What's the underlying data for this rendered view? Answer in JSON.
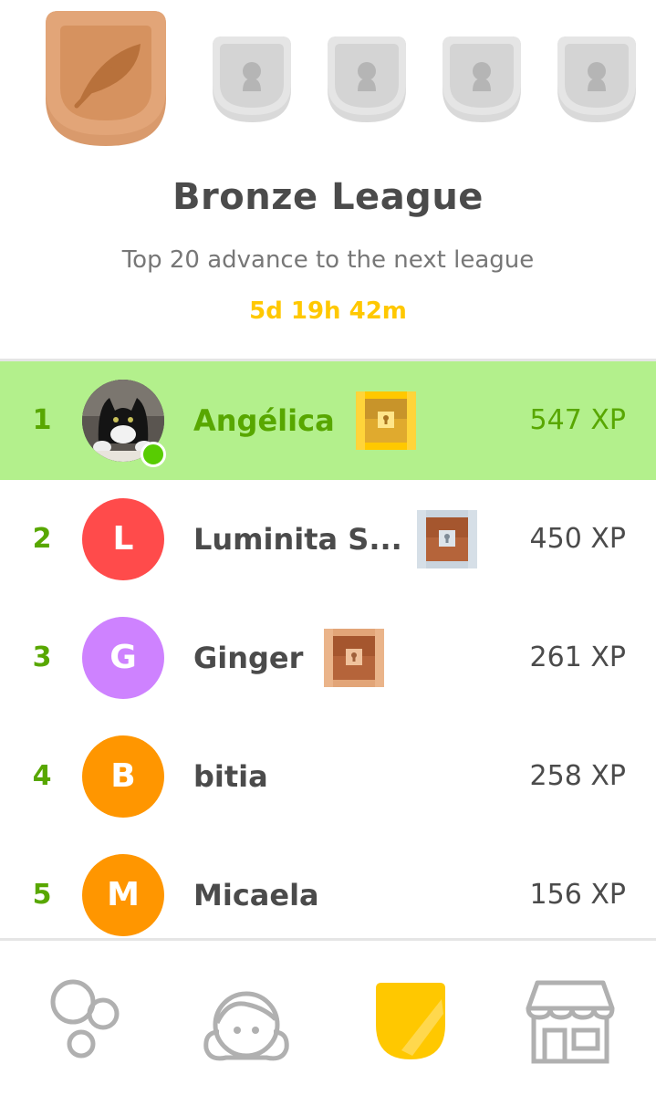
{
  "league": {
    "title": "Bronze League",
    "subtitle": "Top 20 advance to the next league",
    "timer": "5d 19h 42m",
    "badges": [
      {
        "name": "bronze",
        "icon": "feather-icon",
        "locked": false,
        "color": "#cd7f50"
      },
      {
        "name": "locked-1",
        "icon": "lock-icon",
        "locked": true
      },
      {
        "name": "locked-2",
        "icon": "lock-icon",
        "locked": true
      },
      {
        "name": "locked-3",
        "icon": "lock-icon",
        "locked": true
      },
      {
        "name": "locked-4",
        "icon": "lock-icon",
        "locked": true
      }
    ]
  },
  "leaderboard": [
    {
      "rank": "1",
      "initial": "",
      "avatar_color": "#3a3a3a",
      "name": "Angélica",
      "chest": "gold-chest-icon",
      "xp": "547 XP",
      "is_current_user": true,
      "online": true
    },
    {
      "rank": "2",
      "initial": "L",
      "avatar_color": "#ff4b4b",
      "name": "Luminita S...",
      "chest": "silver-chest-icon",
      "xp": "450 XP"
    },
    {
      "rank": "3",
      "initial": "G",
      "avatar_color": "#ce82ff",
      "name": "Ginger",
      "chest": "bronze-chest-icon",
      "xp": "261 XP"
    },
    {
      "rank": "4",
      "initial": "B",
      "avatar_color": "#ff9600",
      "name": "bitia",
      "chest": "",
      "xp": "258 XP"
    },
    {
      "rank": "5",
      "initial": "M",
      "avatar_color": "#ff9600",
      "name": "Micaela",
      "chest": "",
      "xp": "156 XP"
    }
  ],
  "tabbar": [
    {
      "name": "learn",
      "icon": "bubbles-icon"
    },
    {
      "name": "profile",
      "icon": "profile-face-icon"
    },
    {
      "name": "leaderboards",
      "icon": "shield-icon",
      "active": true
    },
    {
      "name": "shop",
      "icon": "shop-icon"
    }
  ],
  "colors": {
    "accent_green": "#58a700",
    "highlight_row": "#b3f08c",
    "timer": "#ffc800",
    "active_tab": "#ffc800"
  }
}
